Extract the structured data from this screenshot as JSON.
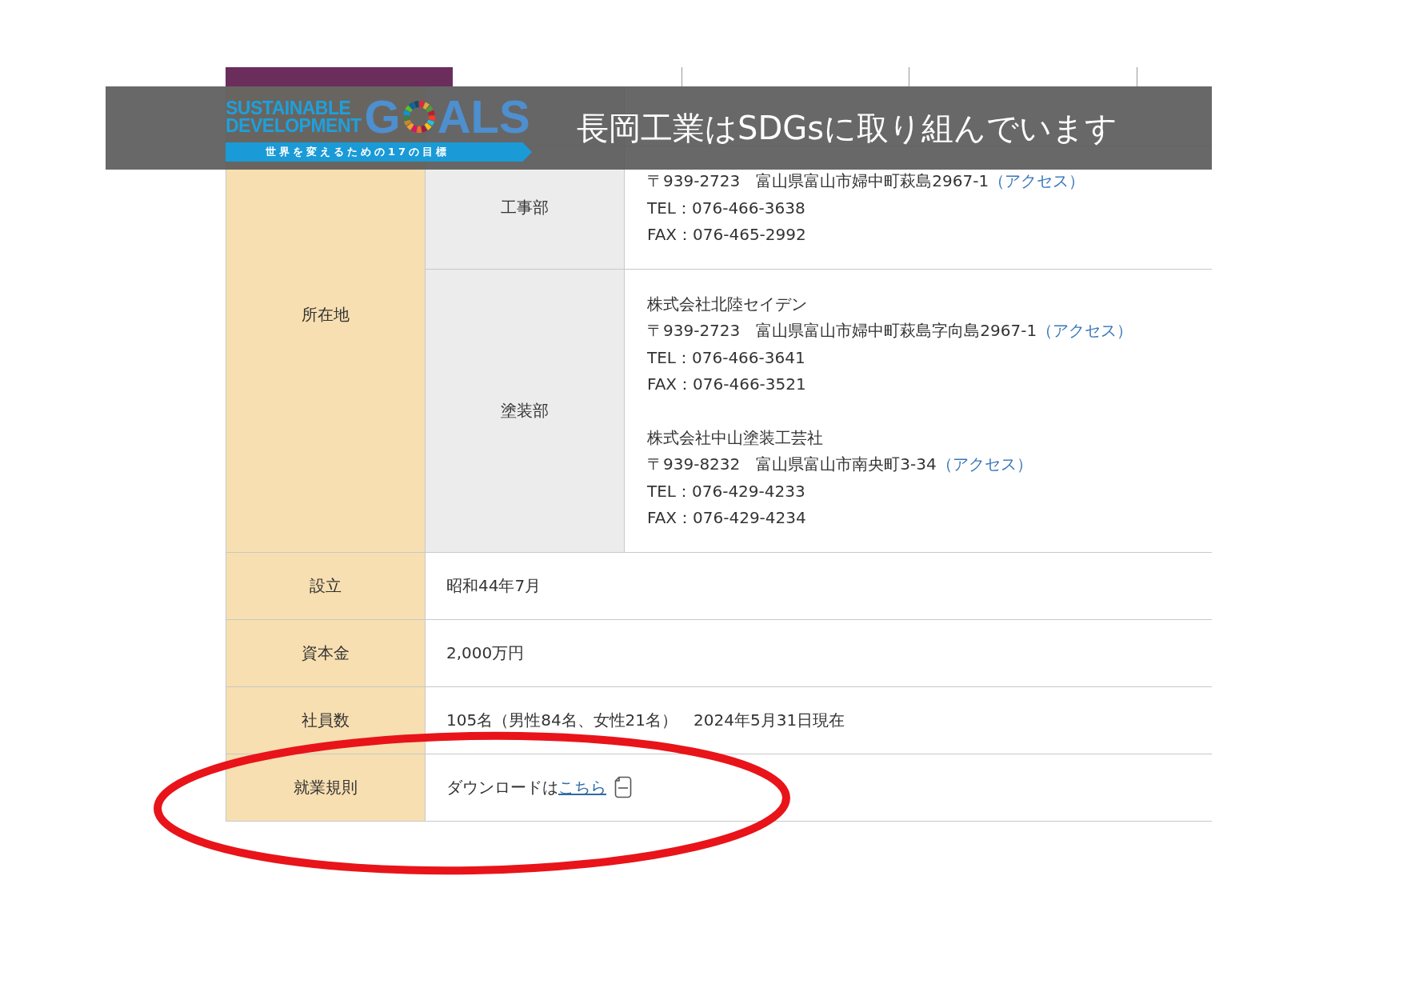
{
  "banner": {
    "title": "長岡工業はSDGsに取り組んでいます",
    "logo": {
      "line_1": "SUSTAINABLE",
      "line_2": "DEVELOPMENT",
      "wordmark_start": "G",
      "wordmark_end": "ALS",
      "tagline": "世界を変えるための17の目標"
    }
  },
  "location": {
    "label": "所在地",
    "departments": [
      {
        "name": "工事部",
        "blocks": [
          [
            {
              "text": "〒939-2723　富山県富山市婦中町萩島2967-1",
              "link": "（アクセス）"
            },
            {
              "text": "TEL：076-466-3638"
            },
            {
              "text": "FAX：076-465-2992"
            }
          ]
        ]
      },
      {
        "name": "塗装部",
        "blocks": [
          [
            {
              "text": "株式会社北陸セイデン"
            },
            {
              "text": "〒939-2723　富山県富山市婦中町萩島字向島2967-1",
              "link": "（アクセス）"
            },
            {
              "text": "TEL：076-466-3641"
            },
            {
              "text": "FAX：076-466-3521"
            }
          ],
          [
            {
              "text": "株式会社中山塗装工芸社"
            },
            {
              "text": "〒939-8232　富山県富山市南央町3-34",
              "link": "（アクセス）"
            },
            {
              "text": "TEL：076-429-4233"
            },
            {
              "text": "FAX：076-429-4234"
            }
          ]
        ]
      }
    ]
  },
  "rows": [
    {
      "kind": "text",
      "label": "設立",
      "value": "昭和44年7月"
    },
    {
      "kind": "text",
      "label": "資本金",
      "value": "2,000万円"
    },
    {
      "kind": "text",
      "label": "社員数",
      "value": "105名（男性84名、女性21名）　2024年5月31日現在"
    },
    {
      "kind": "download",
      "label": "就業規則",
      "value": "ダウンロードは",
      "link": "こちら"
    }
  ]
}
